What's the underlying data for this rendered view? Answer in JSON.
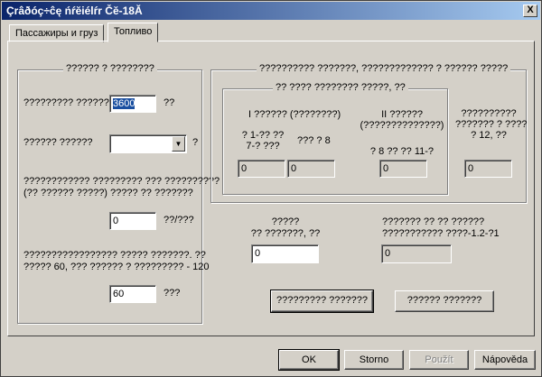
{
  "window": {
    "title": "Çrâðóç÷ĉę ńŕĕiélŕr Čĕ-18Ă",
    "close": "X"
  },
  "tabs": [
    {
      "label": "Пассажиры и груз"
    },
    {
      "label": "Топливо"
    }
  ],
  "left_group": {
    "title": "?????? ? ????????",
    "field1_label": "????????? ??????",
    "field1_value": "3600",
    "field1_unit": "??",
    "field2_label": "?????? ??????",
    "field2_value": "",
    "field2_unit": "?",
    "field3_label_line1": "???????????? ????????? ??? ??????????",
    "field3_label_line2": "(?? ?????? ?????) ????? ?? ???????",
    "field3_value": "0",
    "field3_unit": "??/???",
    "field4_label_line1": "????????????????? ????? ???????. ??",
    "field4_label_line2": "????? 60, ??? ?????? ? ?????????  - 120",
    "field4_value": "60",
    "field4_unit": "???"
  },
  "right_group": {
    "title": "?????????? ???????, ????????????? ? ?????? ?????",
    "inner_title": "?? ???? ???????? ?????, ??",
    "col1_title": "I ?????? (????????)",
    "col1a_label_line1": "? 1-?? ??",
    "col1a_label_line2": "7-? ???",
    "col1a_value": "0",
    "col1b_label": "??? ? 8",
    "col1b_value": "0",
    "col2_title_line1": "II ??????",
    "col2_title_line2": "(??????????????)",
    "col2_label": "? 8 ?? ?? 11-?",
    "col2_value": "0",
    "col3_label_line1": "??????????",
    "col3_label_line2": "??????? ? ????",
    "col3_label_line3": "? 12, ??",
    "col3_value": "0"
  },
  "bottom": {
    "left_label_line1": "?????",
    "left_label_line2": "?? ???????, ??",
    "left_value": "0",
    "right_label_line1": "??????? ?? ?? ??????",
    "right_label_line2": "??????????? ????-1.2-?1",
    "right_value": "0",
    "calc_button": "????????? ???????",
    "clear_button": "?????? ???????"
  },
  "footer": {
    "ok": "OK",
    "cancel": "Storno",
    "apply": "Použít",
    "help": "Nápověda"
  }
}
